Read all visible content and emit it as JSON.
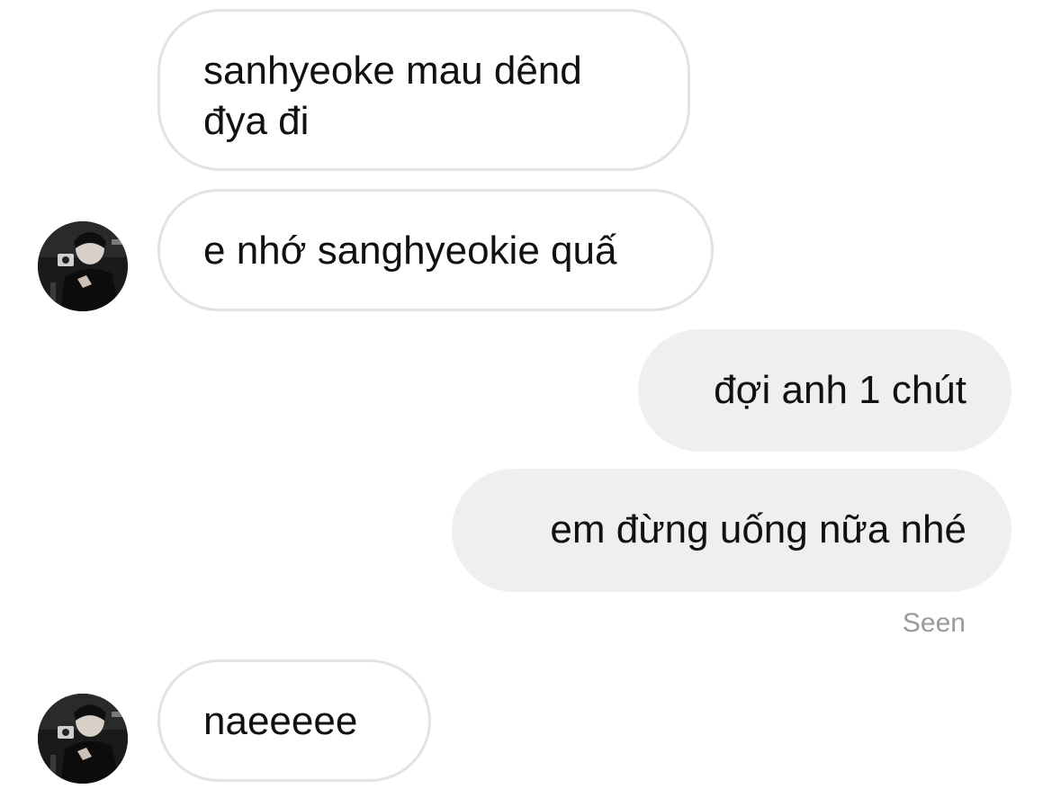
{
  "messages": [
    {
      "from": "other",
      "text": "sanhyeoke mau dênd\nđya đi"
    },
    {
      "from": "other",
      "text": "e nhớ sanghyeokie quấ"
    },
    {
      "from": "me",
      "text": "đợi anh 1 chút"
    },
    {
      "from": "me",
      "text": "em đừng uống nữa nhé"
    },
    {
      "from": "other",
      "text": "naeeeee"
    }
  ],
  "seen_label": "Seen",
  "colors": {
    "incoming_border": "#e3e3e3",
    "outgoing_bg": "#efefef",
    "seen_text": "#9a9a9a"
  },
  "icons": {
    "avatar": "user-avatar-photo"
  }
}
